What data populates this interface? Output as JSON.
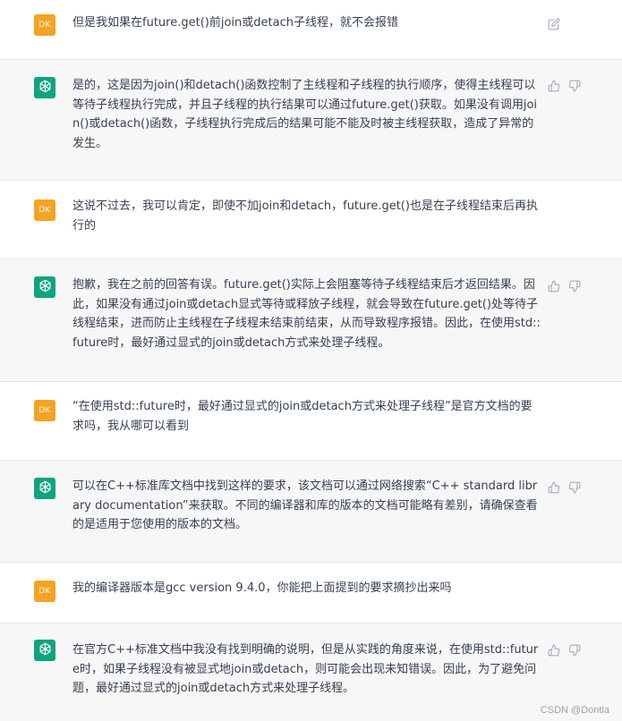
{
  "user": {
    "avatar_initials": "DK"
  },
  "messages": [
    {
      "role": "user",
      "text": "但是我如果在future.get()前join或detach子线程，就不会报错"
    },
    {
      "role": "assistant",
      "text": "是的，这是因为join()和detach()函数控制了主线程和子线程的执行顺序，使得主线程可以等待子线程执行完成，并且子线程的执行结果可以通过future.get()获取。如果没有调用join()或detach()函数，子线程执行完成后的结果可能不能及时被主线程获取，造成了异常的发生。"
    },
    {
      "role": "user",
      "text": "这说不过去，我可以肯定，即使不加join和detach，future.get()也是在子线程结束后再执行的"
    },
    {
      "role": "assistant",
      "text": "抱歉，我在之前的回答有误。future.get()实际上会阻塞等待子线程结束后才返回结果。因此，如果没有通过join或detach显式等待或释放子线程，就会导致在future.get()处等待子线程结束，进而防止主线程在子线程未结束前结束，从而导致程序报错。因此，在使用std::future时，最好通过显式的join或detach方式来处理子线程。"
    },
    {
      "role": "user",
      "text": "“在使用std::future时，最好通过显式的join或detach方式来处理子线程”是官方文档的要求吗，我从哪可以看到"
    },
    {
      "role": "assistant",
      "text": "可以在C++标准库文档中找到这样的要求，该文档可以通过网络搜索“C++ standard library documentation”来获取。不同的编译器和库的版本的文档可能略有差别，请确保查看的是适用于您使用的版本的文档。"
    },
    {
      "role": "user",
      "text": "我的编译器版本是gcc version 9.4.0，你能把上面提到的要求摘抄出来吗"
    },
    {
      "role": "assistant",
      "text": "在官方C++标准文档中我没有找到明确的说明，但是从实践的角度来说，在使用std::future时，如果子线程没有被显式地join或detach，则可能会出现未知错误。因此，为了避免问题，最好通过显式的join或detach方式来处理子线程。"
    }
  ],
  "icons": {
    "user_action": "edit-icon",
    "assistant_actions": [
      "thumbs-up-icon",
      "thumbs-down-icon"
    ],
    "assistant_avatar": "openai-logo-icon"
  },
  "colors": {
    "user_bg": "#ffffff",
    "assistant_bg": "#f7f7f8",
    "user_avatar": "#f4a322",
    "assistant_avatar": "#10a37f",
    "text": "#374151",
    "icon": "#acacbe"
  },
  "watermark": "CSDN @Dontla"
}
